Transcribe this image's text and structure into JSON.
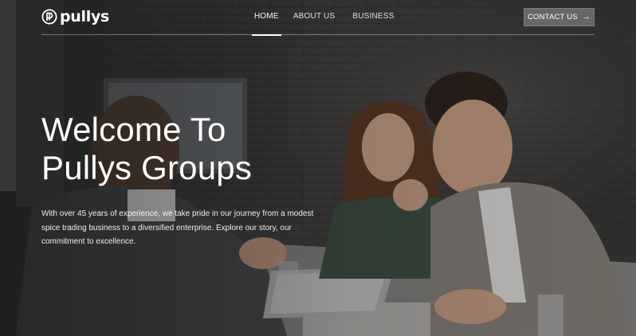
{
  "brand": {
    "name": "pullys",
    "logo_icon": "pullys-logo-icon"
  },
  "nav": {
    "items": [
      {
        "label": "HOME",
        "active": true
      },
      {
        "label": "ABOUT US",
        "active": false
      },
      {
        "label": "BUSINESS",
        "active": false
      }
    ],
    "contact": {
      "label": "CONTACT US",
      "icon": "arrow-right-icon",
      "glyph": "→"
    }
  },
  "hero": {
    "headline_line1": "Welcome To",
    "headline_line2": "Pullys Groups",
    "description": "With over 45 years of experience, we take pride in our journey from a modest spice trading business to a diversified enterprise. Explore our story, our commitment to excellence.",
    "background_image": "business-meeting-photo"
  },
  "colors": {
    "overlay": "#0a0a0a",
    "text": "#ffffff",
    "button_bg": "#8a8a8a"
  }
}
